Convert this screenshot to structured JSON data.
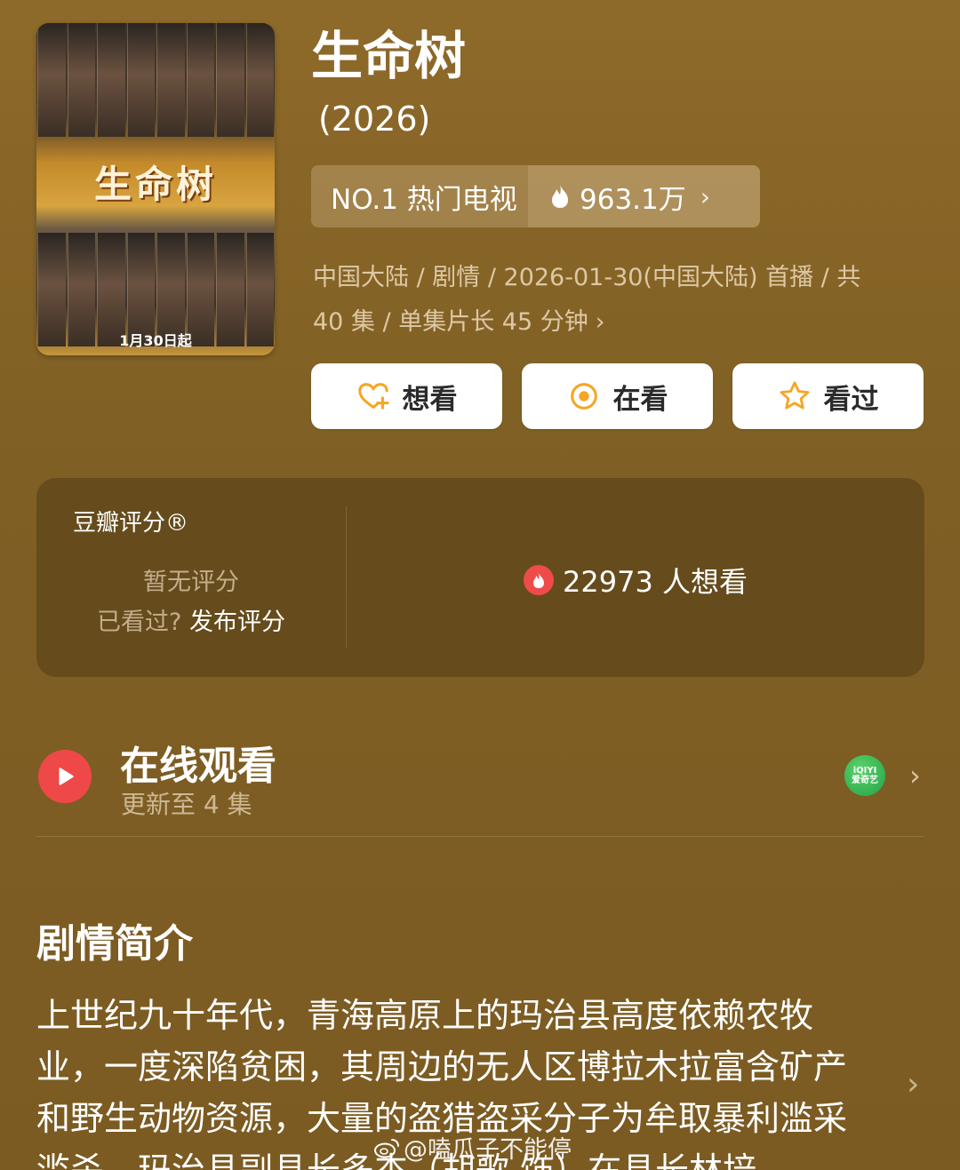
{
  "poster": {
    "logo_text": "生命树",
    "date_text": "1月30日起"
  },
  "show": {
    "title": "生命树",
    "year": "(2026)",
    "rank": "NO.1 热门电视",
    "heat": "963.1万",
    "meta_line1": "中国大陆 / 剧情 / 2026-01-30(中国大陆) 首播 / 共",
    "meta_line2": "40 集 / 单集片长 45 分钟"
  },
  "actions": {
    "want": "想看",
    "watching": "在看",
    "watched": "看过"
  },
  "rating": {
    "label": "豆瓣评分®",
    "no_rating": "暂无评分",
    "prompt": "已看过?",
    "post": "发布评分",
    "want_count": "22973 人想看"
  },
  "online": {
    "title": "在线观看",
    "subtitle": "更新至 4 集",
    "provider_logo": "iQIYI 爱奇艺"
  },
  "synopsis": {
    "heading": "剧情简介",
    "text": "上世纪九十年代，青海高原上的玛治县高度依赖农牧业，一度深陷贫困，其周边的无人区博拉木拉富含矿产和野生动物资源，大量的盗猎盗采分子为牟取暴利滥采滥杀。玛治县副县长多杰（胡歌 饰）在县长林培"
  },
  "watermark": {
    "text": "@嗑瓜子不能停"
  },
  "icons": [
    "heart-plus-icon",
    "target-icon",
    "star-icon",
    "fire-icon",
    "play-icon",
    "chevron-right-icon",
    "weibo-icon"
  ],
  "colors": {
    "background": "#8e6a2a",
    "accent_orange": "#f5a623",
    "play_red": "#ef4848"
  }
}
